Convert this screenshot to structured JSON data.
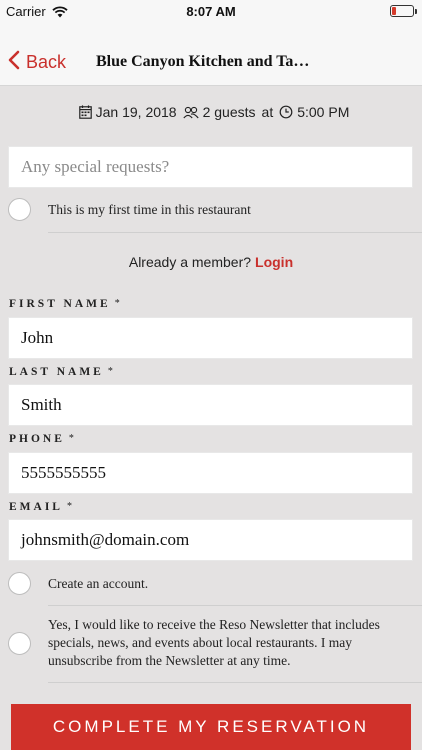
{
  "status_bar": {
    "carrier": "Carrier",
    "time": "8:07 AM"
  },
  "nav": {
    "back_label": "Back",
    "title": "Blue Canyon Kitchen and Ta…"
  },
  "reservation": {
    "date": "Jan 19, 2018",
    "guests": "2 guests",
    "at": "at",
    "time": "5:00 PM"
  },
  "special_requests": {
    "placeholder": "Any special requests?"
  },
  "first_time": {
    "label": "This is my first time in this restaurant"
  },
  "member": {
    "text": "Already a member?",
    "login": "Login"
  },
  "form": {
    "first_name": {
      "label": "FIRST NAME",
      "required": "*",
      "value": "John"
    },
    "last_name": {
      "label": "LAST NAME",
      "required": "*",
      "value": "Smith"
    },
    "phone": {
      "label": "PHONE",
      "required": "*",
      "value": "5555555555"
    },
    "email": {
      "label": "EMAIL",
      "required": "*",
      "value": "johnsmith@domain.com"
    }
  },
  "create_account": {
    "label": "Create an account."
  },
  "newsletter": {
    "label": "Yes, I would like to receive the Reso Newsletter that includes specials, news, and events about local restaurants. I may unsubscribe from the Newsletter at any time."
  },
  "cta": {
    "label": "COMPLETE MY RESERVATION"
  },
  "colors": {
    "accent": "#d0312a",
    "background": "#e4e2e2"
  }
}
